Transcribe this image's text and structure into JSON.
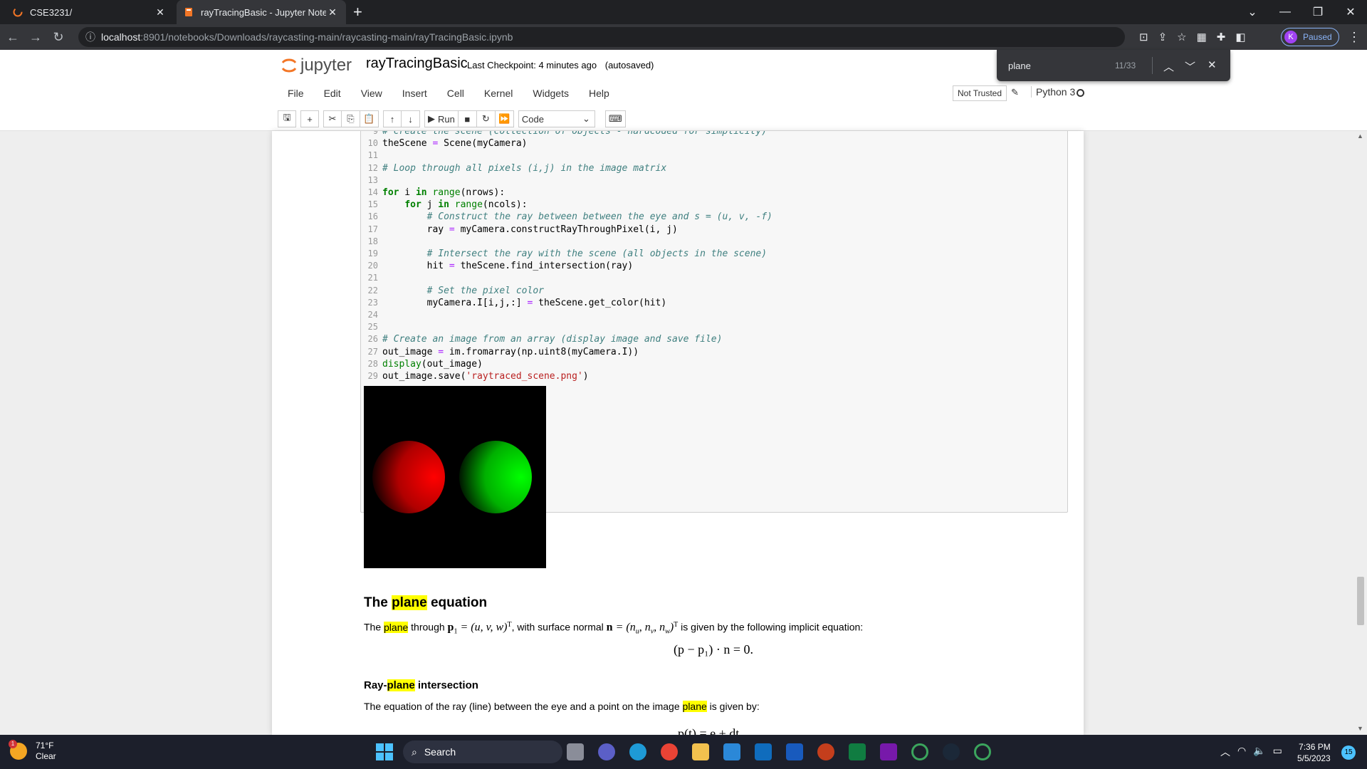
{
  "browser": {
    "tabs": [
      {
        "title": "CSE3231/"
      },
      {
        "title": "rayTracingBasic - Jupyter Notebo"
      }
    ],
    "url_host": "localhost",
    "url_path": ":8901/notebooks/Downloads/raycasting-main/raycasting-main/rayTracingBasic.ipynb",
    "profile_initial": "K",
    "profile_status": "Paused"
  },
  "find": {
    "query": "plane",
    "count": "11/33"
  },
  "jupyter": {
    "logo_text": "jupyter",
    "notebook_name": "rayTracingBasic",
    "checkpoint": "Last Checkpoint: 4 minutes ago",
    "autosave": "(autosaved)",
    "menu": [
      "File",
      "Edit",
      "View",
      "Insert",
      "Cell",
      "Kernel",
      "Widgets",
      "Help"
    ],
    "trust": "Not Trusted",
    "kernel": "Python 3",
    "toolbar": {
      "run_label": "Run",
      "cell_type": "Code"
    }
  },
  "code": {
    "lines": [
      {
        "n": "9",
        "t": "# create the scene (collection of objects - hardcoded for simplicity)"
      },
      {
        "n": "10",
        "t": "theScene = Scene(myCamera)"
      },
      {
        "n": "11",
        "t": ""
      },
      {
        "n": "12",
        "t": "# Loop through all pixels (i,j) in the image matrix"
      },
      {
        "n": "13",
        "t": ""
      },
      {
        "n": "14",
        "t": "for i in range(nrows):"
      },
      {
        "n": "15",
        "t": "    for j in range(ncols):"
      },
      {
        "n": "16",
        "t": "        # Construct the ray between between the eye and s = (u, v, -f)"
      },
      {
        "n": "17",
        "t": "        ray = myCamera.constructRayThroughPixel(i, j)"
      },
      {
        "n": "18",
        "t": ""
      },
      {
        "n": "19",
        "t": "        # Intersect the ray with the scene (all objects in the scene)"
      },
      {
        "n": "20",
        "t": "        hit = theScene.find_intersection(ray)"
      },
      {
        "n": "21",
        "t": ""
      },
      {
        "n": "22",
        "t": "        # Set the pixel color"
      },
      {
        "n": "23",
        "t": "        myCamera.I[i,j,:] = theScene.get_color(hit)"
      },
      {
        "n": "24",
        "t": ""
      },
      {
        "n": "25",
        "t": ""
      },
      {
        "n": "26",
        "t": "# Create an image from an array (display image and save file)"
      },
      {
        "n": "27",
        "t": "out_image = im.fromarray(np.uint8(myCamera.I))"
      },
      {
        "n": "28",
        "t": "display(out_image)"
      },
      {
        "n": "29",
        "t": "out_image.save('raytraced_scene.png')"
      }
    ]
  },
  "markdown": {
    "heading_prefix": "The ",
    "heading_hl": "plane",
    "heading_suffix": " equation",
    "para1_a": "The ",
    "para1_hl": "plane",
    "para1_b": " through ",
    "para1_p1": "p",
    "para1_eq": " = (u, v, w)",
    "para1_T": "T",
    "para1_c": ", with surface normal ",
    "para1_n": "n",
    "para1_eq2": " = (n",
    "para1_sub_u": "u",
    "para1_mid": ", n",
    "para1_sub_v": "v",
    "para1_mid2": ", n",
    "para1_sub_w": "w",
    "para1_close": ")",
    "para1_T2": "T",
    "para1_d": " is given by the following implicit equation:",
    "eq1": "(p − p₁) · n = 0.",
    "sub_heading_a": "Ray-",
    "sub_heading_hl": "plane",
    "sub_heading_b": " intersection",
    "para2_a": "The equation of the ray (line) between the eye and a point on the image ",
    "para2_hl": "plane",
    "para2_b": " is given by:",
    "eq2": "p(t) = e + dt"
  },
  "taskbar": {
    "temp": "71°F",
    "cond": "Clear",
    "weather_badge": "1",
    "search": "Search",
    "time": "7:36 PM",
    "date": "5/5/2023",
    "notif_count": "15"
  }
}
